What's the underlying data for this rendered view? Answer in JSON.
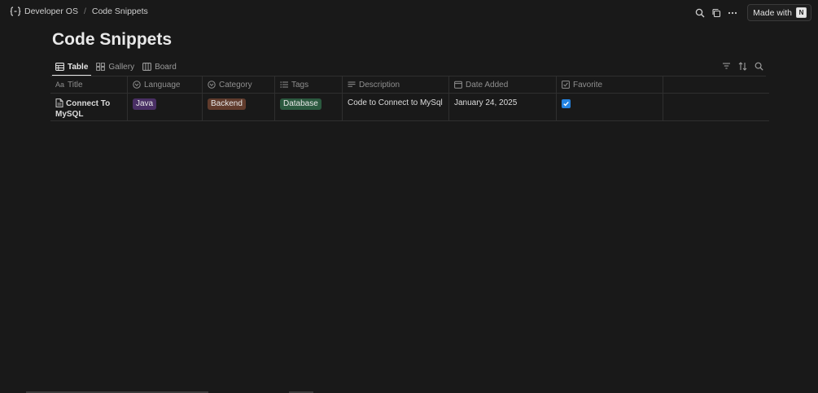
{
  "breadcrumb": {
    "workspace": "Developer OS",
    "separator": "/",
    "page": "Code Snippets"
  },
  "top_actions": {
    "made_with_label": "Made with",
    "made_with_logo": "N"
  },
  "page_title": "Code Snippets",
  "views": [
    {
      "label": "Table",
      "icon": "table-icon",
      "active": true
    },
    {
      "label": "Gallery",
      "icon": "gallery-icon",
      "active": false
    },
    {
      "label": "Board",
      "icon": "board-icon",
      "active": false
    }
  ],
  "columns": {
    "title": {
      "label": "Title",
      "icon": "Aa"
    },
    "language": {
      "label": "Language",
      "icon": "select-icon"
    },
    "category": {
      "label": "Category",
      "icon": "select-icon"
    },
    "tags": {
      "label": "Tags",
      "icon": "list-icon"
    },
    "description": {
      "label": "Description",
      "icon": "text-lines-icon"
    },
    "date_added": {
      "label": "Date Added",
      "icon": "calendar-icon"
    },
    "favorite": {
      "label": "Favorite",
      "icon": "checkbox-icon"
    }
  },
  "rows": [
    {
      "title": "Connect To MySQL",
      "language": {
        "label": "Java",
        "color": "#492f64"
      },
      "category": {
        "label": "Backend",
        "color": "#603b2c"
      },
      "tags": {
        "label": "Database",
        "color": "#2b593f"
      },
      "description": "Code to Connect to MySql",
      "date_added": "January 24, 2025",
      "favorite": true
    }
  ]
}
